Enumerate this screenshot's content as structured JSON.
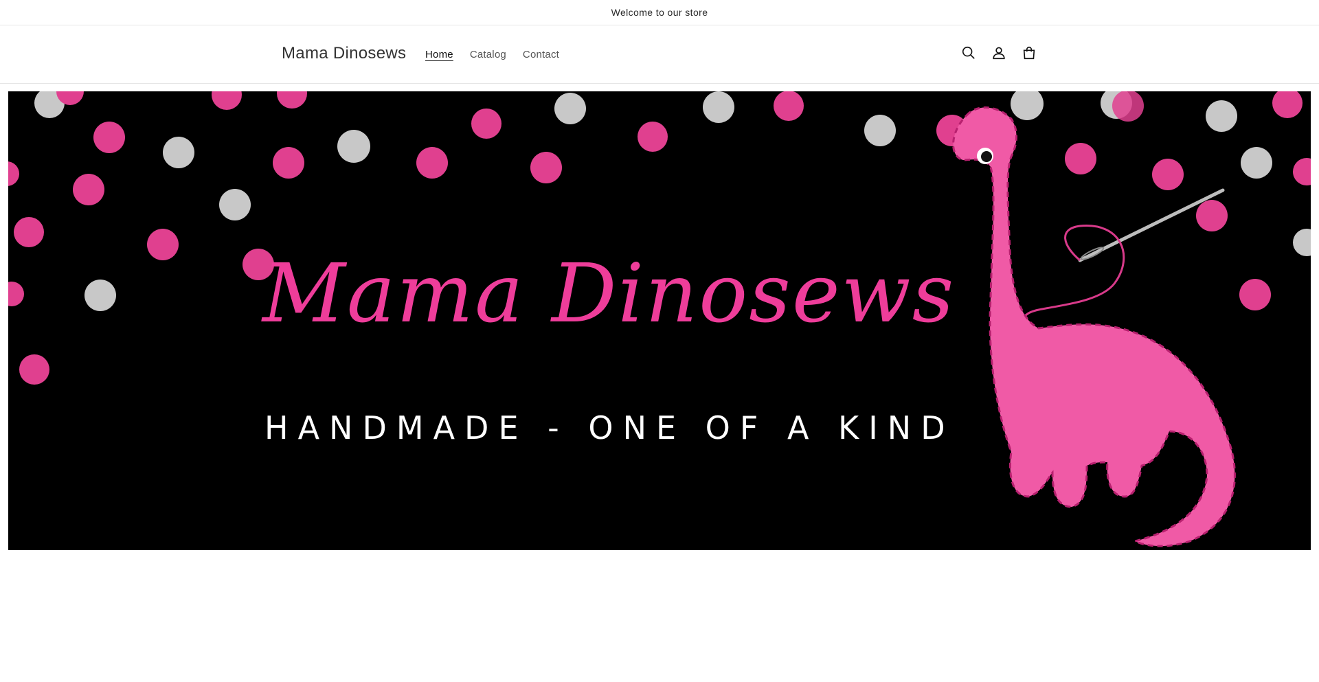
{
  "announcement": {
    "text": "Welcome to our store"
  },
  "header": {
    "logo": "Mama Dinosews",
    "nav": [
      {
        "label": "Home",
        "active": true
      },
      {
        "label": "Catalog",
        "active": false
      },
      {
        "label": "Contact",
        "active": false
      }
    ],
    "icons": [
      "search-icon",
      "account-icon",
      "cart-icon"
    ]
  },
  "hero": {
    "title": "Mama Dinosews",
    "tagline": "HANDMADE - ONE OF A KIND",
    "background_color": "#000000",
    "accent_pink": "#ee3d9a",
    "dot_gray": "#c8c8c8"
  }
}
